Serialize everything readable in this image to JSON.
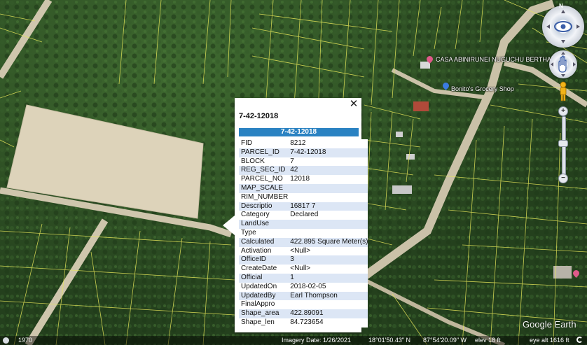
{
  "popup": {
    "title": "7-42-12018",
    "header": "7-42-12018",
    "close_glyph": "✕",
    "attributes": [
      {
        "key": "FID",
        "value": "8212"
      },
      {
        "key": "PARCEL_ID",
        "value": "7-42-12018"
      },
      {
        "key": "BLOCK",
        "value": "7"
      },
      {
        "key": "REG_SEC_ID",
        "value": "42"
      },
      {
        "key": "PARCEL_NO",
        "value": "12018"
      },
      {
        "key": "MAP_SCALE",
        "value": ""
      },
      {
        "key": "RIM_NUMBER",
        "value": ""
      },
      {
        "key": "Descriptio",
        "value": "16817 7"
      },
      {
        "key": "Category",
        "value": "Declared"
      },
      {
        "key": "LandUse",
        "value": ""
      },
      {
        "key": "Type",
        "value": ""
      },
      {
        "key": "Calculated",
        "value": "422.895 Square Meter(s)"
      },
      {
        "key": "Activation",
        "value": "<Null>"
      },
      {
        "key": "OfficeID",
        "value": "3"
      },
      {
        "key": "CreateDate",
        "value": "<Null>"
      },
      {
        "key": "Official",
        "value": "1"
      },
      {
        "key": "UpdatedOn",
        "value": "2018-02-05"
      },
      {
        "key": "UpdatedBy",
        "value": "Earl Thompson"
      },
      {
        "key": "FinalAppro",
        "value": ""
      },
      {
        "key": "Shape_area",
        "value": "422.89091"
      },
      {
        "key": "Shape_len",
        "value": "84.723654"
      }
    ]
  },
  "map_labels": {
    "place1": "CASA ABINIRUNEI NUGUCHU BERTHA",
    "place2": "Bonito's Grocery Shop"
  },
  "controls": {
    "north": "N",
    "zoom_in": "+",
    "zoom_out": "−"
  },
  "status": {
    "year": "1970",
    "imagery_date": "Imagery Date: 1/26/2021",
    "lat": "18°01'50.43\" N",
    "lon": "87°54'20.09\" W",
    "elev": "elev   18 ft",
    "eye_alt": "eye alt  1616 ft"
  },
  "logo": "Google Earth",
  "colors": {
    "popup_header": "#2a82c2",
    "parcel_lines": "#e6e65a",
    "pin_blue": "#3b7be0",
    "pin_pink": "#e05a8a"
  }
}
